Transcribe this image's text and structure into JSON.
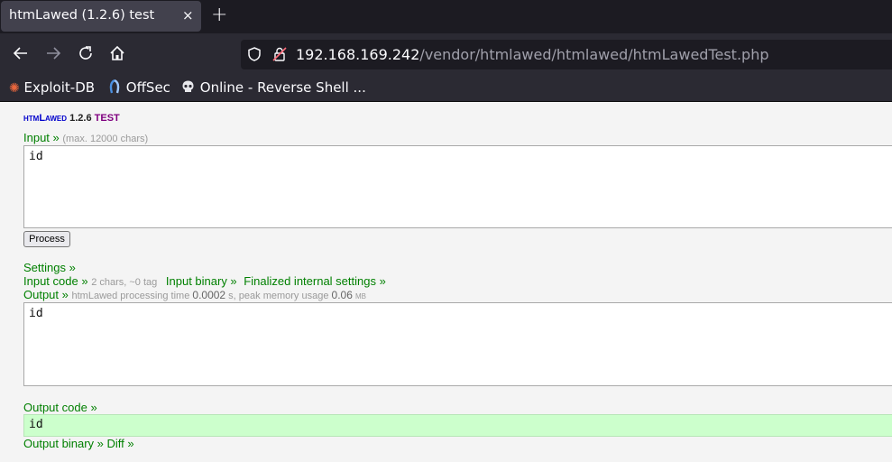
{
  "browser": {
    "tab_title": "htmLawed (1.2.6) test",
    "tab_close": "×",
    "new_tab": "+",
    "url_host": "192.168.169.242",
    "url_path": "/vendor/htmlawed/htmlawed/htmLawedTest.php",
    "bookmarks": [
      {
        "label": "Exploit-DB"
      },
      {
        "label": "OffSec"
      },
      {
        "label": "Online - Reverse Shell ..."
      }
    ]
  },
  "page": {
    "title_part1": "htmLawed",
    "title_version": "1.2.6",
    "title_part2": "test",
    "input_label": "Input »",
    "input_hint": "(max. 12000 chars)",
    "input_value": "id",
    "process_button": "Process",
    "settings_label": "Settings »",
    "input_code_label": "Input code »",
    "input_code_hint": "2 chars, ~0 tag",
    "input_binary_label": "Input binary »",
    "finalized_label": "Finalized internal settings »",
    "output_label": "Output »",
    "output_hint_prefix": "htmLawed processing time",
    "output_time": "0.0002",
    "output_hint_mid": "s, peak memory usage",
    "output_memory": "0.06",
    "output_unit": "MB",
    "output_value": "id",
    "output_code_label": "Output code »",
    "output_code_value": "id",
    "output_binary_label": "Output binary »",
    "diff_label": "Diff »"
  }
}
